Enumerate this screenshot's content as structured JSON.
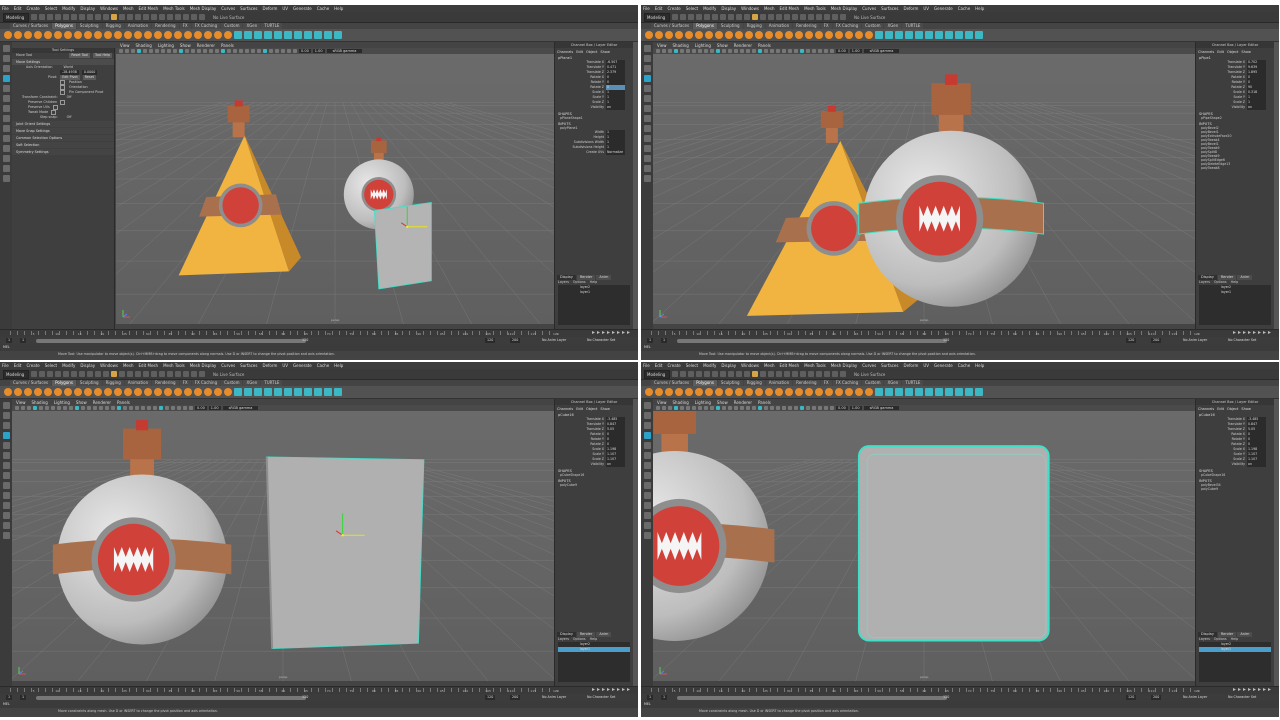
{
  "menu": [
    "File",
    "Edit",
    "Create",
    "Select",
    "Modify",
    "Display",
    "Windows",
    "Mesh",
    "Edit Mesh",
    "Mesh Tools",
    "Mesh Display",
    "Curves",
    "Surfaces",
    "Deform",
    "UV",
    "Generate",
    "Cache",
    "Help"
  ],
  "status": {
    "mode": "Modeling",
    "live_surface": "No Live Surface"
  },
  "shelf_tabs": [
    "Curves / Surfaces",
    "Polygons",
    "Sculpting",
    "Rigging",
    "Animation",
    "Rendering",
    "FX",
    "FX Caching",
    "Custom",
    "XGen",
    "TURTLE"
  ],
  "panel_menu": [
    "View",
    "Shading",
    "Lighting",
    "Show",
    "Renderer",
    "Panels"
  ],
  "camera_label": "persp",
  "gamma_label": "sRGB gamma",
  "exposure_value": "0.00",
  "gamma_value": "1.00",
  "channel_box": {
    "title": "Channel Box / Layer Editor",
    "tabs": [
      "Channels",
      "Edit",
      "Object",
      "Show"
    ],
    "attrs": [
      "Translate X",
      "Translate Y",
      "Translate Z",
      "Rotate X",
      "Rotate Y",
      "Rotate Z",
      "Scale X",
      "Scale Y",
      "Scale Z",
      "Visibility"
    ],
    "shapes_label": "SHAPES",
    "inputs_label": "INPUTS"
  },
  "layer_editor": {
    "tabs": [
      "Display",
      "Render",
      "Anim"
    ],
    "menu": [
      "Layers",
      "Options",
      "Help"
    ],
    "layers": [
      "layer2",
      "layer1"
    ]
  },
  "tool_settings": {
    "title": "Tool Settings",
    "tool": "Move Tool",
    "reset": "Reset Tool",
    "help": "Tool Help",
    "section": "Move Settings",
    "axis_orientation_label": "Axis Orientation",
    "axis_orientation_value": "World",
    "values": [
      "-28.4938",
      "0.0000"
    ],
    "pivot_label": "Pivot:",
    "edit_pivot": "Edit Pivot",
    "reset_btn": "Reset",
    "checks": [
      "Position",
      "Orientation",
      "Pin Component Pivot"
    ],
    "transform_constraint_label": "Transform Constraint:",
    "transform_constraint_value": "Off",
    "preserve": [
      "Preserve Children",
      "Preserve UVs",
      "Tweak Mode"
    ],
    "step_snap_label": "Step snap:",
    "step_snap_value": "Off",
    "sections": [
      "Joint Orient Settings",
      "Move Snap Settings",
      "Common Selection Options",
      "Soft Selection",
      "Symmetry Settings"
    ]
  },
  "timeslider": {
    "ticks": [
      "5",
      "10",
      "15",
      "20",
      "25",
      "30",
      "35",
      "40",
      "45",
      "50",
      "55",
      "60",
      "65",
      "70",
      "75",
      "80",
      "85",
      "90",
      "95",
      "100",
      "105",
      "110",
      "115",
      "120"
    ],
    "current": "1"
  },
  "range": {
    "start": "1",
    "start2": "1",
    "end": "120",
    "end2": "120",
    "max": "200",
    "anim_layer": "No Anim Layer",
    "char_set": "No Character Set"
  },
  "cmd_label": "MEL",
  "help_line_1": "Move Tool: Use manipulator to move object(s). Ctrl+MMB+drag to move components along normals. Use D or INSERT to change the pivot position and axis orientation.",
  "help_line_2": "Move constraints along mesh. Use D or INSERT to change the pivot position and axis orientation.",
  "panes": [
    {
      "object": "pPlane1",
      "values": [
        "-6.507",
        "0.471",
        "2.379",
        "0",
        "0",
        "0",
        "1",
        "1",
        "1",
        "on"
      ],
      "shapes": [
        "pPlaneShape1"
      ],
      "inputs": [
        "polyPlane1"
      ],
      "extra_attrs": [
        [
          "Width",
          "1"
        ],
        [
          "Height",
          "1"
        ],
        [
          "Subdivisions Width",
          "1"
        ],
        [
          "Subdivisions Height",
          "1"
        ],
        [
          "Create UVs",
          "Normalize"
        ]
      ]
    },
    {
      "object": "pPipe1",
      "values": [
        "0.702",
        "9.639",
        "1.895",
        "0",
        "0",
        "90",
        "0.318",
        "1",
        "1",
        "on"
      ],
      "shapes": [
        "pPipeShape2"
      ],
      "inputs": [
        "polyBevel2",
        "polyBevel1",
        "polyExtrudeFace20",
        "polyTweak4",
        "polyBevel1",
        "polyTweak9",
        "polySplit8",
        "polyTweak9",
        "polySplitEdge6",
        "polyDeleteEdge13",
        "polyTweak8"
      ],
      "extra_attrs": []
    },
    {
      "object": "pCube16",
      "values": [
        "-3.485",
        "0.847",
        "5.05",
        "0",
        "0",
        "0",
        "1.198",
        "1.107",
        "1.107",
        "on"
      ],
      "shapes": [
        "pCubeShape16"
      ],
      "inputs": [
        "polyCube9"
      ],
      "extra_attrs": []
    },
    {
      "object": "pCube16",
      "values": [
        "-3.485",
        "0.847",
        "5.05",
        "0",
        "0",
        "0",
        "1.198",
        "1.107",
        "1.107",
        "on"
      ],
      "shapes": [
        "pCubeShape16"
      ],
      "inputs": [
        "polyBevel34",
        "polyCube9"
      ],
      "extra_attrs": []
    }
  ],
  "colors": {
    "viewport": "#646464",
    "selection": "#3fe0c8",
    "potion_yellow": "#f2b440",
    "cork": "#b8734a",
    "cap": "#c73a30",
    "band": "#a9704e",
    "label_red": "#d0413a",
    "sphere": "#cfcfcf"
  }
}
